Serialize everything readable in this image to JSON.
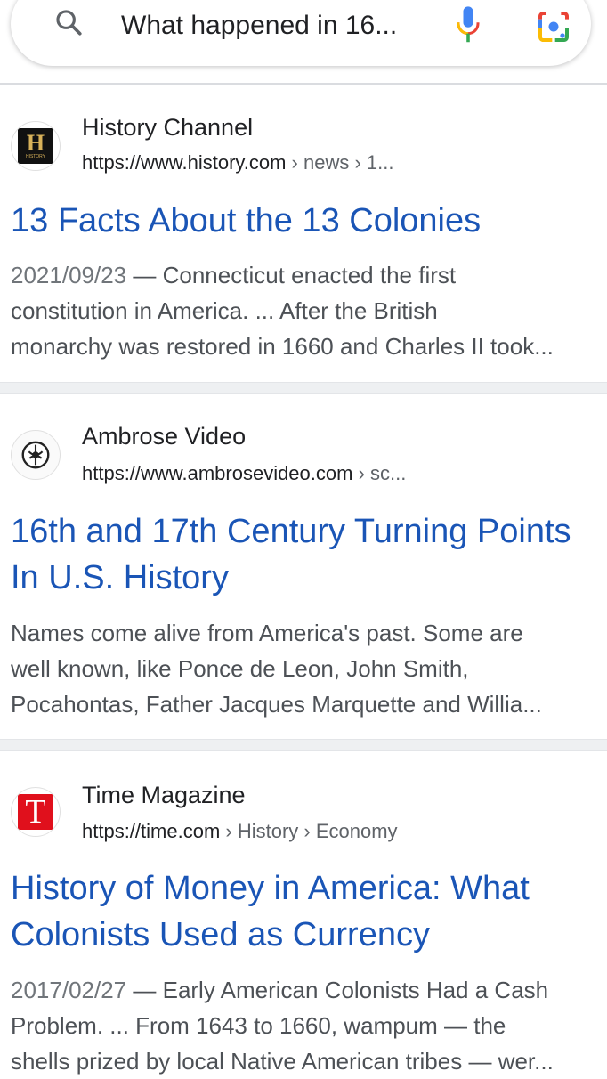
{
  "search": {
    "query": "What happened in 16...",
    "search_icon": "search-icon",
    "mic_icon": "microphone-icon",
    "lens_icon": "google-lens-icon"
  },
  "results": [
    {
      "site_name": "History Channel",
      "favicon": "history-logo-icon",
      "favicon_text": "H",
      "favicon_subtext": "HISTORY",
      "url_base": "https://www.history.com",
      "url_path": " › news › 1...",
      "title": "13 Facts About the 13 Colonies",
      "date": "2021/09/23",
      "snippet_lines": [
        "— Connecticut enacted the first",
        "constitution in America. ... After the British",
        "monarchy was restored in 1660 and Charles II took..."
      ]
    },
    {
      "site_name": "Ambrose Video",
      "favicon": "ambrose-logo-icon",
      "url_base": "https://www.ambrosevideo.com",
      "url_path": " › sc...",
      "title_lines": [
        "16th and 17th Century Turning Points",
        "In U.S. History"
      ],
      "snippet_lines": [
        "Names come alive from America's past. Some are",
        "well known, like Ponce de Leon, John Smith,",
        "Pocahontas, Father Jacques Marquette and Willia..."
      ]
    },
    {
      "site_name": "Time Magazine",
      "favicon": "time-logo-icon",
      "favicon_text": "T",
      "url_base": "https://time.com",
      "url_path": " › History › Economy",
      "title_lines": [
        "History of Money in America: What",
        "Colonists Used as Currency"
      ],
      "date": "2017/02/27",
      "snippet_lines": [
        "— Early American Colonists Had a Cash",
        "Problem. ... From 1643 to 1660, wampum — the",
        "shells prized by local Native American tribes — wer..."
      ]
    }
  ],
  "colors": {
    "link": "#1a55b6",
    "background": "#ffffff",
    "separator": "#eef0f2"
  }
}
